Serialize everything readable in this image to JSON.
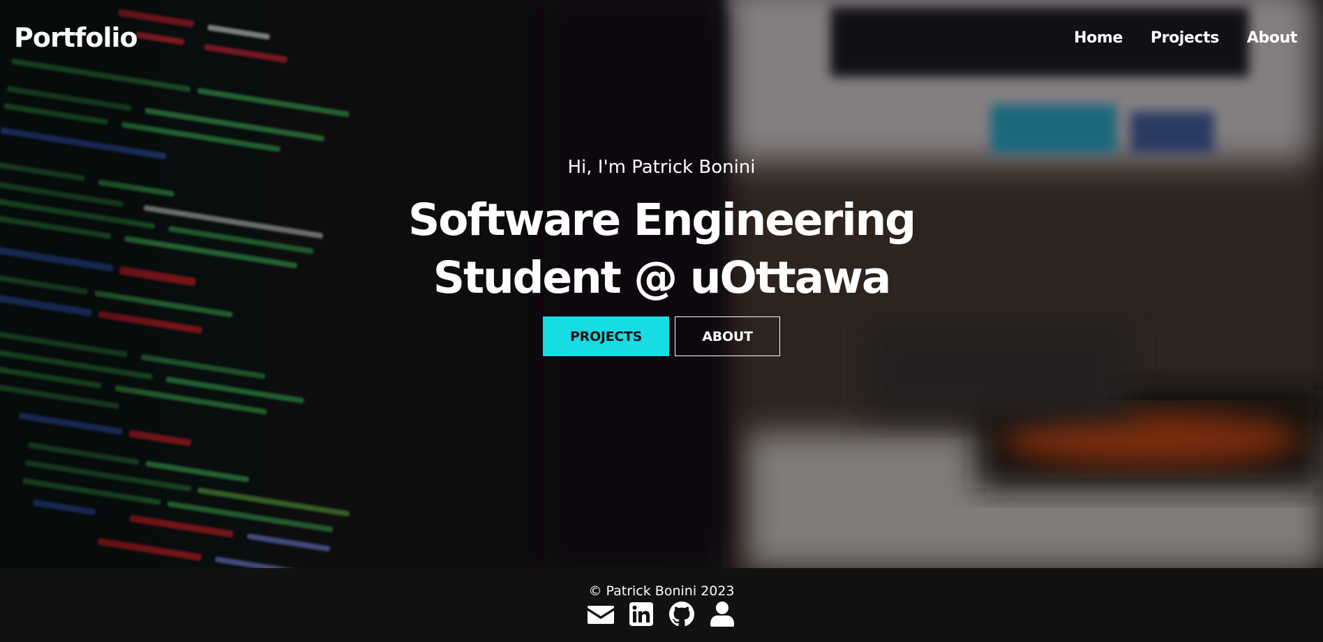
{
  "nav": {
    "brand": "Portfolio",
    "links": [
      {
        "label": "Home"
      },
      {
        "label": "Projects"
      },
      {
        "label": "About"
      }
    ]
  },
  "hero": {
    "intro": "Hi, I'm Patrick Bonini",
    "headline": "Software Engineering Student @ uOttawa",
    "buttons": {
      "primary": "PROJECTS",
      "secondary": "ABOUT"
    },
    "background": "blurred-code-on-monitor-photo"
  },
  "footer": {
    "copyright": "© Patrick Bonini 2023",
    "socials": [
      {
        "icon": "envelope-icon"
      },
      {
        "icon": "linkedin-icon"
      },
      {
        "icon": "github-icon"
      },
      {
        "icon": "user-icon"
      }
    ]
  },
  "colors": {
    "accent": "#17dce4",
    "footer_bg": "#111111",
    "text": "#ffffff"
  }
}
